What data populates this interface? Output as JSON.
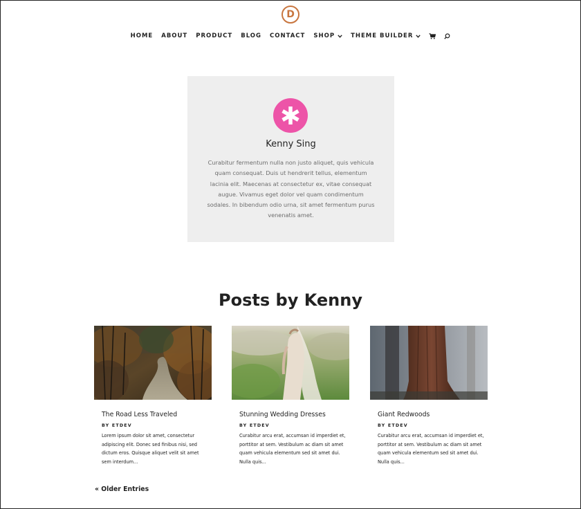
{
  "logo": {
    "letter": "D",
    "icon": "divi-logo-icon",
    "color": "#c8753e"
  },
  "nav": {
    "items": [
      {
        "label": "HOME"
      },
      {
        "label": "ABOUT"
      },
      {
        "label": "PRODUCT"
      },
      {
        "label": "BLOG"
      },
      {
        "label": "CONTACT"
      },
      {
        "label": "SHOP",
        "has_dropdown": true
      },
      {
        "label": "THEME BUILDER",
        "has_dropdown": true
      }
    ],
    "cart_icon": "cart-icon",
    "search_icon": "search-icon"
  },
  "author_card": {
    "avatar_icon": "asterisk-icon",
    "avatar_color": "#ed54a8",
    "background": "#eeeeee",
    "name": "Kenny Sing",
    "bio": "Curabitur fermentum nulla non justo aliquet, quis vehicula quam consequat. Duis ut hendrerit tellus, elementum lacinia elit. Maecenas at consectetur ex, vitae consequat augue. Vivamus eget dolor vel quam condimentum sodales. In bibendum odio urna, sit amet fermentum purus venenatis amet."
  },
  "posts_section": {
    "title": "Posts by Kenny",
    "posts": [
      {
        "image": "forest-path-photo",
        "title": "The Road Less Traveled",
        "by": "BY",
        "author": "ETDEV",
        "excerpt": "Lorem ipsum dolor sit amet, consectetur adipiscing elit. Donec sed finibus nisi, sed dictum eros. Quisque aliquet velit sit amet sem interdum..."
      },
      {
        "image": "bride-dress-photo",
        "title": "Stunning Wedding Dresses",
        "by": "BY",
        "author": "ETDEV",
        "excerpt": "Curabitur arcu erat, accumsan id imperdiet et, porttitor at sem. Vestibulum ac diam sit amet quam vehicula elementum sed sit amet dui. Nulla quis..."
      },
      {
        "image": "redwoods-photo",
        "title": "Giant Redwoods",
        "by": "BY",
        "author": "ETDEV",
        "excerpt": "Curabitur arcu erat, accumsan id imperdiet et, porttitor at sem. Vestibulum ac diam sit amet quam vehicula elementum sed sit amet dui. Nulla quis..."
      }
    ]
  },
  "pagination": {
    "older_label": "« Older Entries"
  }
}
